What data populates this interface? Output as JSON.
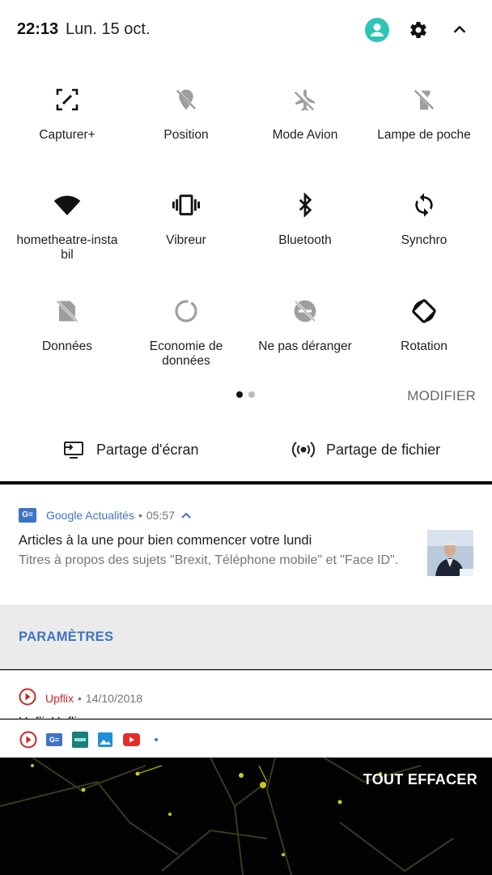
{
  "status_bar": {
    "time": "22:13",
    "date": "Lun. 15 oct.",
    "icons": [
      "account-icon",
      "settings-gear-icon",
      "chevron-up-icon"
    ]
  },
  "tiles": [
    {
      "label": "Capturer+",
      "icon": "screenshot-edit-icon",
      "active": true
    },
    {
      "label": "Position",
      "icon": "location-off-icon",
      "active": false
    },
    {
      "label": "Mode Avion",
      "icon": "airplane-off-icon",
      "active": false
    },
    {
      "label": "Lampe de poche",
      "icon": "flashlight-off-icon",
      "active": false
    },
    {
      "label": "hometheatre-instable",
      "icon": "wifi-icon",
      "active": true
    },
    {
      "label": "Vibreur",
      "icon": "vibrate-icon",
      "active": true
    },
    {
      "label": "Bluetooth",
      "icon": "bluetooth-icon",
      "active": true
    },
    {
      "label": "Synchro",
      "icon": "sync-icon",
      "active": true
    },
    {
      "label": "Données",
      "icon": "mobile-data-off-icon",
      "active": false
    },
    {
      "label": "Economie de données",
      "icon": "data-saver-icon",
      "active": false
    },
    {
      "label": "Ne pas déranger",
      "icon": "do-not-disturb-off-icon",
      "active": false
    },
    {
      "label": "Rotation",
      "icon": "auto-rotate-icon",
      "active": true
    }
  ],
  "tile_labels_display": {
    "wifi_line1": "hometheatre-insta",
    "wifi_line2": "bil",
    "eco_line1": "Economie de",
    "eco_line2": "données"
  },
  "pager": {
    "pages": 2,
    "current": 1
  },
  "modifier_label": "MODIFIER",
  "share": {
    "screen": "Partage d'écran",
    "file": "Partage de fichier"
  },
  "notification_1": {
    "app": "Google Actualités",
    "separator": "•",
    "time": "05:57",
    "title": "Articles à la une pour bien commencer votre lundi",
    "body": "Titres à propos des sujets \"Brexit, Téléphone mobile\" et \"Face ID\"."
  },
  "settings_action": "PARAMÈTRES",
  "notification_2": {
    "app": "Upflix",
    "separator": "•",
    "date": "14/10/2018",
    "title_cut": "UpflixUpflix"
  },
  "shelf_icons": [
    "upflix-icon",
    "google-news-icon",
    "app-icon-teal",
    "gallery-icon",
    "youtube-icon",
    "more-dot-icon"
  ],
  "clear_all": "TOUT EFFACER",
  "colors": {
    "accent_blue": "#3f73c6",
    "active_icon": "#111111",
    "inactive_icon": "#9e9e9e",
    "account_teal": "#2ec4b6",
    "upflix_red": "#c62828"
  }
}
